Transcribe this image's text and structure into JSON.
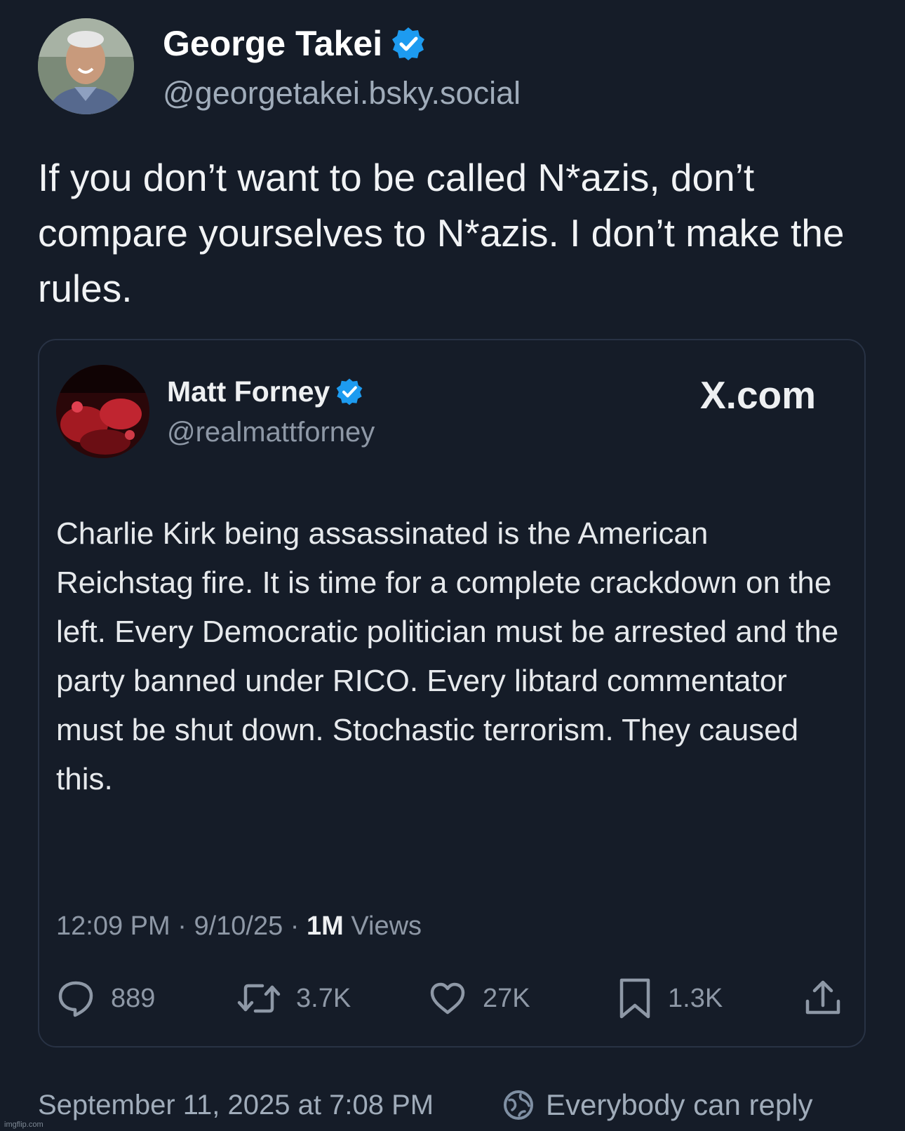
{
  "post": {
    "author_name": "George Takei",
    "author_handle": "@georgetakei.bsky.social",
    "text": "If you don’t want to be called N*azis, don’t compare yourselves to N*azis. I don’t make the rules.",
    "timestamp": "September 11, 2025 at 7:08 PM",
    "reply_setting": "Everybody can reply"
  },
  "quoted": {
    "author_name": "Matt Forney",
    "author_handle": "@realmattforney",
    "source": "X.com",
    "text": "Charlie Kirk being assassinated is the American Reichstag fire. It is time for a complete crackdown on the left. Every Democratic politician must be arrested and the party banned under RICO. Every libtard commentator must be shut down. Stochastic terrorism. They caused this.",
    "time": "12:09 PM",
    "date": "9/10/25",
    "views_count": "1M",
    "views_label": "Views",
    "stats": {
      "replies": "889",
      "reposts": "3.7K",
      "likes": "27K",
      "bookmarks": "1.3K"
    }
  },
  "watermark": "imgflip.com",
  "colors": {
    "background": "#151c28",
    "verified_badge": "#1d9bf0",
    "muted_text": "#a0acba"
  },
  "icons": [
    "verified-badge-icon",
    "reply-icon",
    "repost-icon",
    "like-icon",
    "bookmark-icon",
    "share-icon",
    "globe-icon"
  ]
}
